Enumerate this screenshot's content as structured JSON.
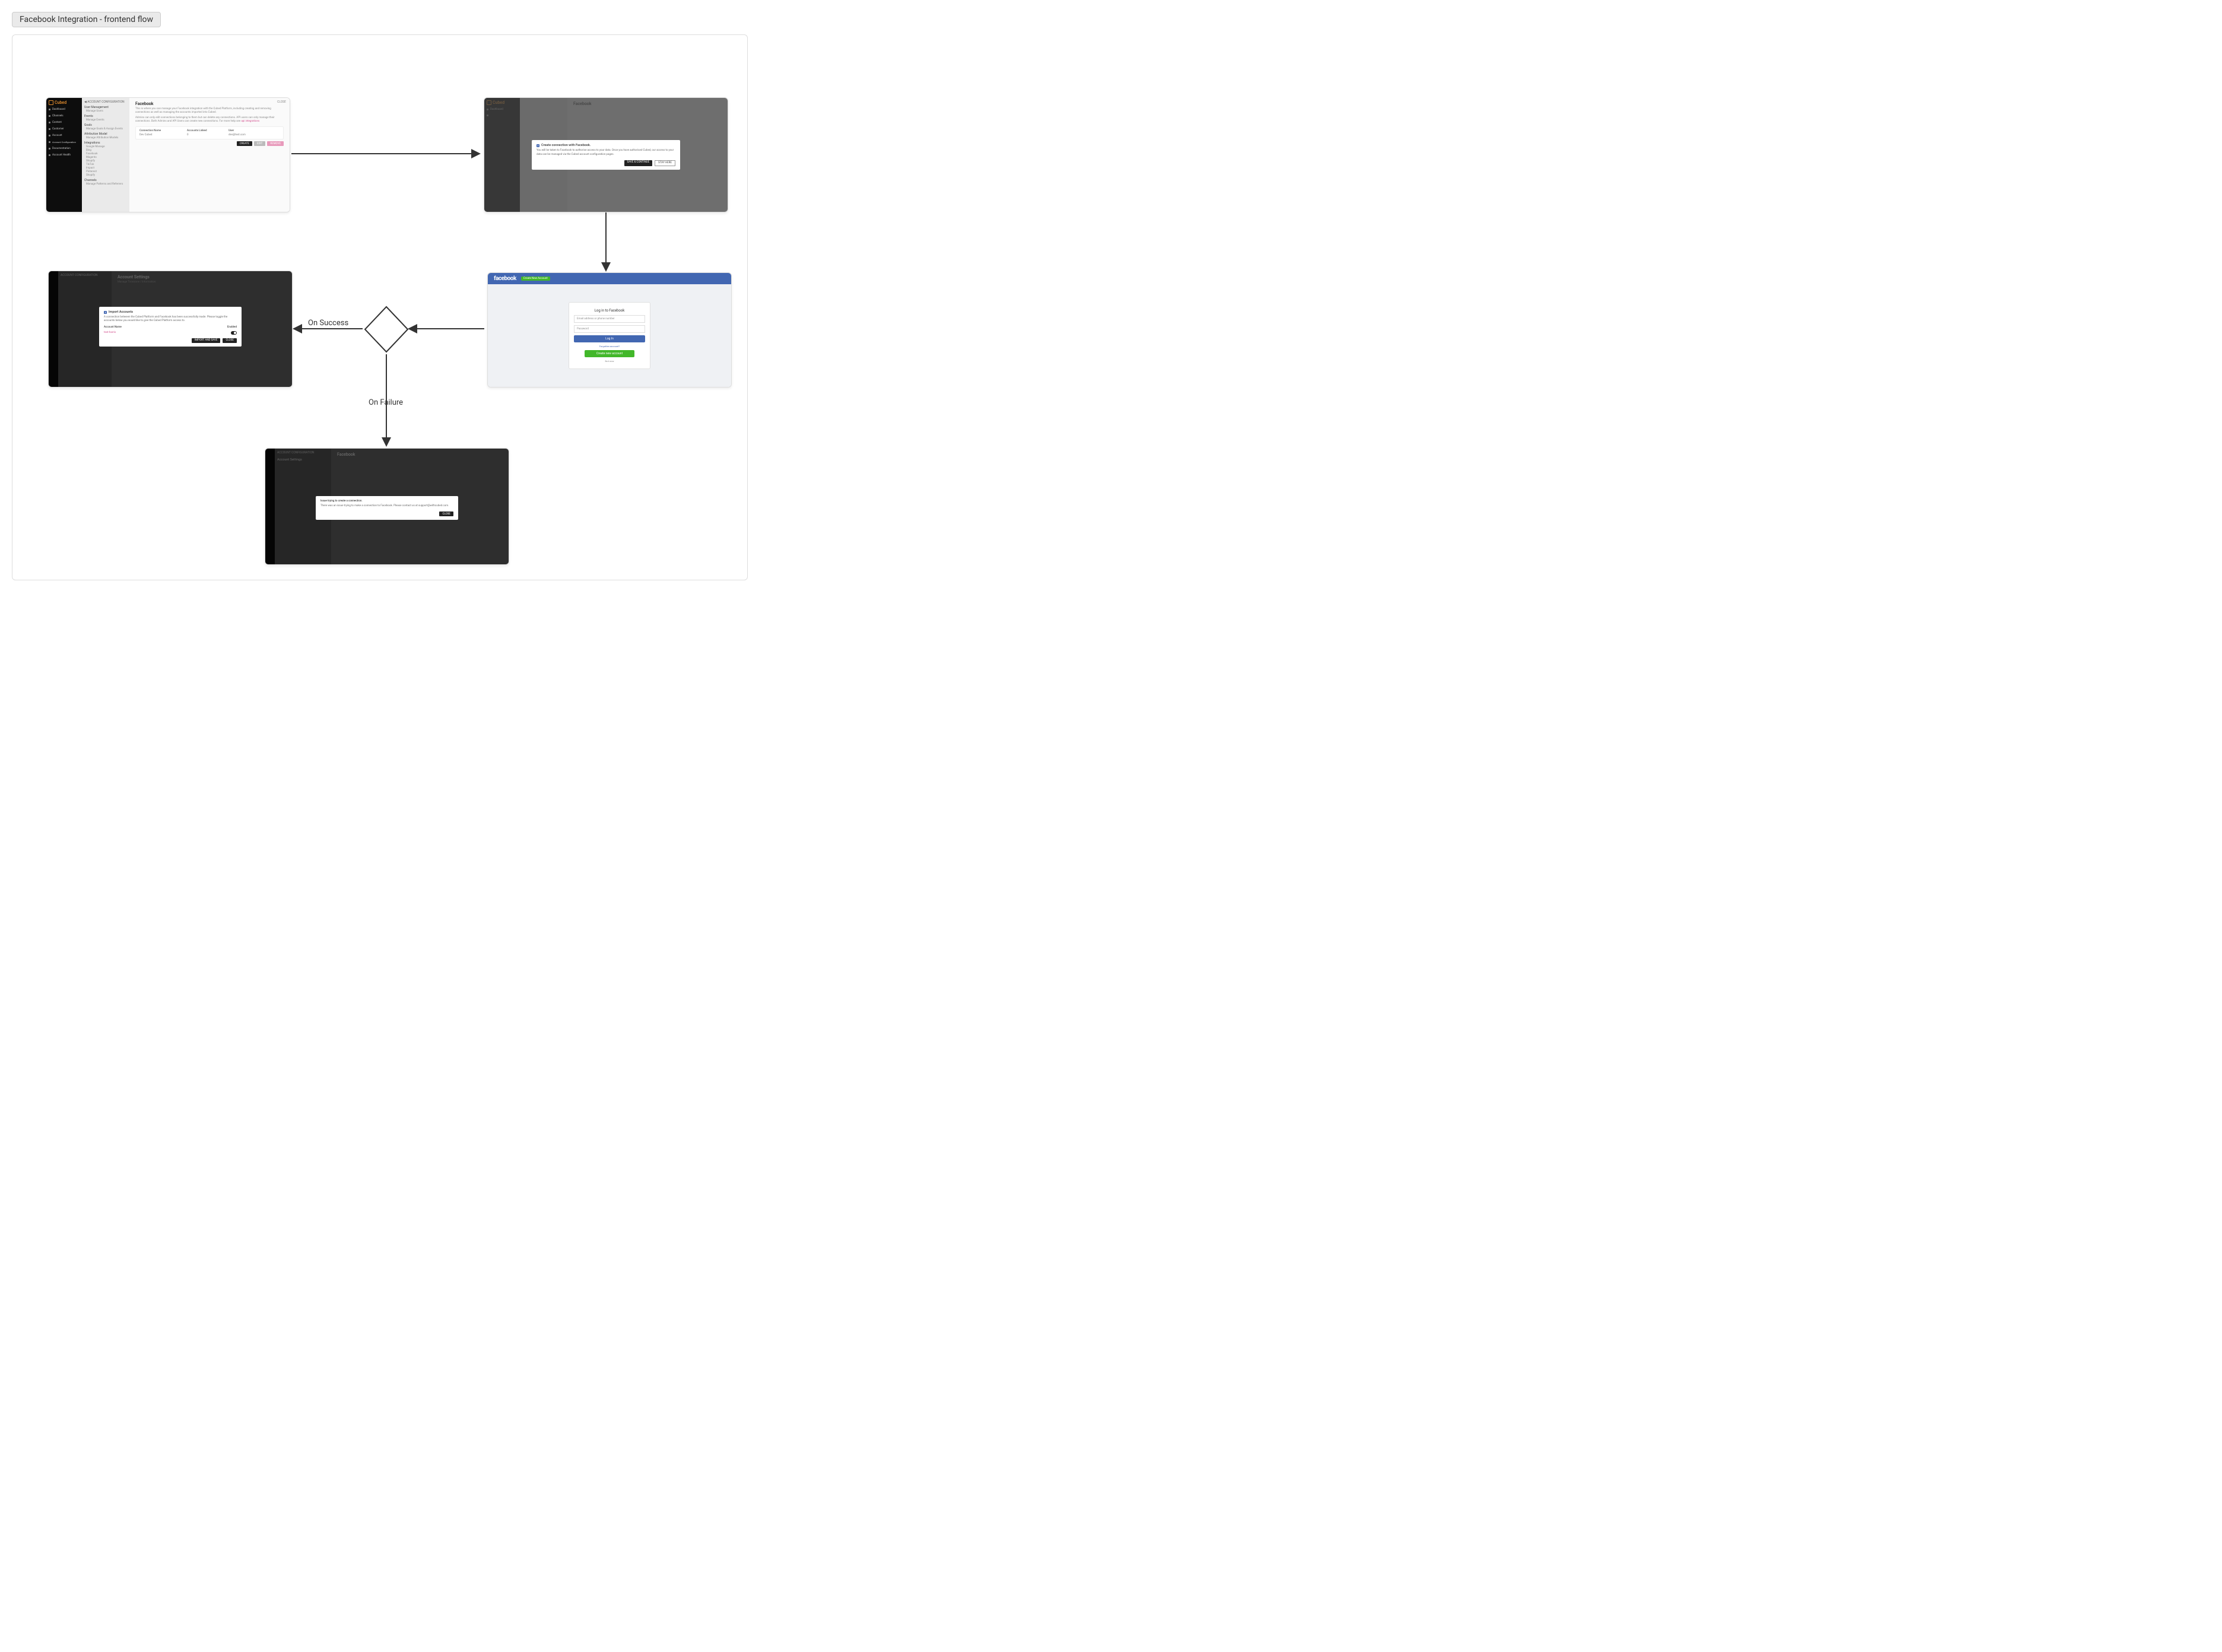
{
  "diagram_title": "Facebook Integration - frontend flow",
  "flow": {
    "on_success": "On Success",
    "on_failure": "On Failure"
  },
  "cubed": {
    "brand": "Cubed",
    "sidebar": [
      "Dashboard",
      "Channels",
      "Content",
      "Customer",
      "Account",
      "Account Configuration",
      "Documentation",
      "Account Health"
    ],
    "nav2": {
      "back": "ACCOUNT CONFIGURATION",
      "groups": [
        {
          "h": "User Management",
          "items": [
            "Manage Users"
          ]
        },
        {
          "h": "Events",
          "items": [
            "Manage Events"
          ]
        },
        {
          "h": "Goals",
          "items": [
            "Manage Goals & Assign Events"
          ]
        },
        {
          "h": "Attribution Model",
          "items": [
            "Manage Attribution Models"
          ]
        },
        {
          "h": "Integrations",
          "items": [
            "Google Manage",
            "Bing",
            "Facebook",
            "Magento",
            "Shopify",
            "TikTok",
            "Impact",
            "Pinterest",
            "Shopify"
          ]
        },
        {
          "h": "Channels",
          "items": [
            "Manage Patterns and Referrers"
          ]
        }
      ]
    },
    "main": {
      "close": "CLOSE",
      "title": "Facebook",
      "desc1": "This is where you can manage your Facebook integration with the Cubed Platform, including creating and removing connections as well as managing the accounts imported into Cubed.",
      "desc2_a": "Admins can only edit connections belonging to them but can delete any connections. API users can only manage their connections. Both Admins and API Users can create new connections. For more help see ",
      "desc2_link": "api integrations",
      "table": {
        "headers": [
          "Connection Name",
          "Accounts Linked",
          "User"
        ],
        "row": [
          "Dev Cubed",
          "0",
          "dev@test.com"
        ]
      },
      "buttons": {
        "create": "CREATE",
        "edit": "EDIT",
        "remove": "REMOVE"
      }
    }
  },
  "create_modal": {
    "title": "Create connection with Facebook.",
    "body": "You will be taken to Facebook to authorise access to your data. Once you have authorised Cubed, our access to your data can be managed via the Cubed account configuration pages.",
    "save": "SAVE & CONTINUE",
    "stay": "STAY HERE"
  },
  "facebook": {
    "logo": "facebook",
    "create_top": "Create New Account",
    "title": "Log in to Facebook",
    "email_ph": "Email address or phone number",
    "password_ph": "Password",
    "login_btn": "Log In",
    "forgot": "Forgotten account?",
    "create_btn": "Create new account",
    "not_now": "Not now"
  },
  "import_modal": {
    "title": "Import Accounts",
    "body": "A connection between the Cubed Platform and Facebook has been successfully made. Please toggle the accounts below you would like to give the Cubed Platform access to.",
    "col1": "Account Name",
    "col2": "Enabled",
    "account": "test-harris",
    "import_btn": "IMPORT AND SAVE",
    "close_btn": "CLOSE"
  },
  "settings_page": {
    "title": "Account Settings",
    "sub": "Manage Timezone / Information"
  },
  "failure_modal": {
    "title": "Issue trying to create a connection.",
    "body": "There was an issue trying to make a connection to Facebook. Please contact us at support@withcubed.com.",
    "close_btn": "CLOSE"
  }
}
